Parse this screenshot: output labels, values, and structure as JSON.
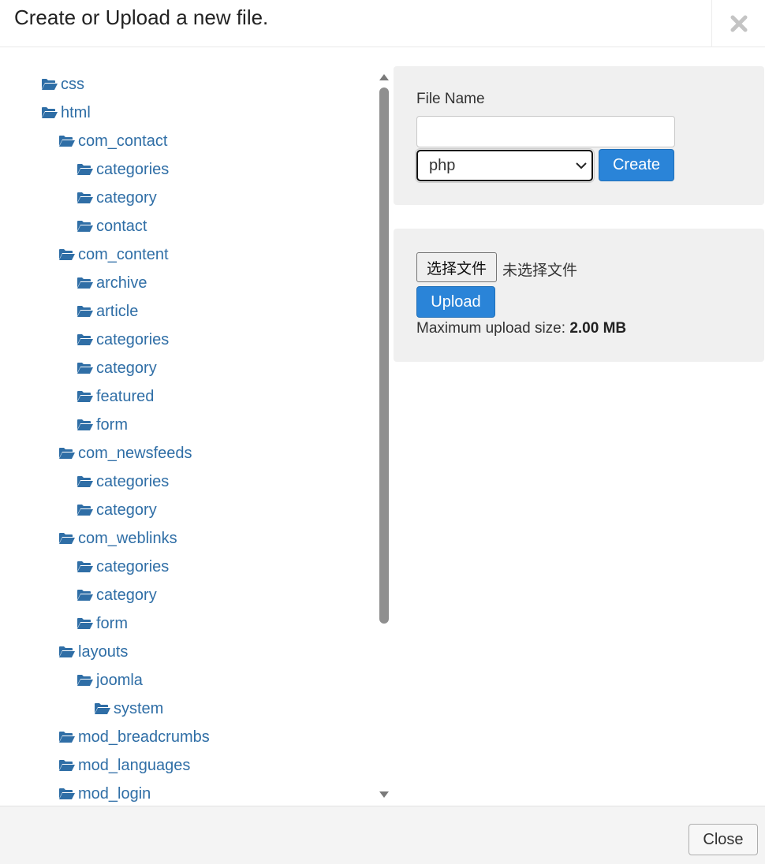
{
  "header": {
    "title": "Create or Upload a new file.",
    "close_icon": "close-x-icon"
  },
  "tree": {
    "folder_icon": "folder-open-icon",
    "folder_color": "#2f6ea6",
    "items": [
      {
        "label": "css",
        "level": 0
      },
      {
        "label": "html",
        "level": 0
      },
      {
        "label": "com_contact",
        "level": 1
      },
      {
        "label": "categories",
        "level": 2
      },
      {
        "label": "category",
        "level": 2
      },
      {
        "label": "contact",
        "level": 2
      },
      {
        "label": "com_content",
        "level": 1
      },
      {
        "label": "archive",
        "level": 2
      },
      {
        "label": "article",
        "level": 2
      },
      {
        "label": "categories",
        "level": 2
      },
      {
        "label": "category",
        "level": 2
      },
      {
        "label": "featured",
        "level": 2
      },
      {
        "label": "form",
        "level": 2
      },
      {
        "label": "com_newsfeeds",
        "level": 1
      },
      {
        "label": "categories",
        "level": 2
      },
      {
        "label": "category",
        "level": 2
      },
      {
        "label": "com_weblinks",
        "level": 1
      },
      {
        "label": "categories",
        "level": 2
      },
      {
        "label": "category",
        "level": 2
      },
      {
        "label": "form",
        "level": 2
      },
      {
        "label": "layouts",
        "level": 1
      },
      {
        "label": "joomla",
        "level": 2
      },
      {
        "label": "system",
        "level": 3
      },
      {
        "label": "mod_breadcrumbs",
        "level": 1
      },
      {
        "label": "mod_languages",
        "level": 1
      },
      {
        "label": "mod_login",
        "level": 1
      }
    ]
  },
  "create_panel": {
    "file_name_label": "File Name",
    "file_name_value": "",
    "extension_selected": "php",
    "create_label": "Create"
  },
  "upload_panel": {
    "choose_file_label": "选择文件",
    "no_file_text": "未选择文件",
    "upload_label": "Upload",
    "max_size_prefix": "Maximum upload size:",
    "max_size_value": "2.00 MB"
  },
  "footer": {
    "close_label": "Close"
  },
  "colors": {
    "accent": "#2a84d8",
    "link": "#2f6ea6",
    "panel_bg": "#f0f0f0"
  }
}
